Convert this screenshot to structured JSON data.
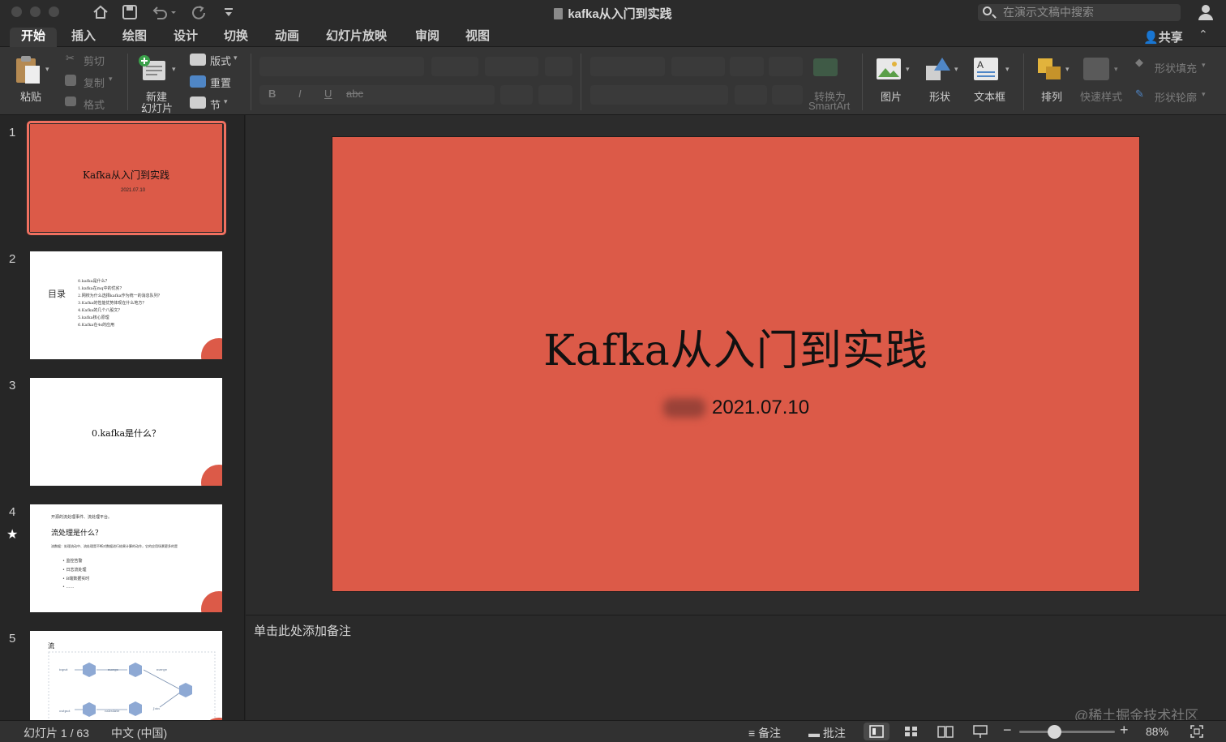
{
  "window": {
    "doc_title": "kafka从入门到实践",
    "search_placeholder": "在演示文稿中搜索"
  },
  "ribbon_tabs": [
    "开始",
    "插入",
    "绘图",
    "设计",
    "切换",
    "动画",
    "幻灯片放映",
    "审阅",
    "视图"
  ],
  "active_tab": "开始",
  "share_label": "共享",
  "ribbon": {
    "paste": "粘贴",
    "cut": "剪切",
    "copy": "复制",
    "format": "格式",
    "new_slide_line1": "新建",
    "new_slide_line2": "幻灯片",
    "layout": "版式",
    "reset": "重置",
    "section": "节",
    "bold": "B",
    "italic": "I",
    "underline": "U",
    "strike": "abc",
    "convert_smartart_line1": "转换为",
    "convert_smartart_line2": "SmartArt",
    "picture": "图片",
    "shape": "形状",
    "textbox": "文本框",
    "arrange": "排列",
    "quick_styles": "快速样式",
    "shape_fill": "形状填充",
    "shape_outline": "形状轮廓"
  },
  "thumbnails": [
    {
      "num": "1",
      "title": "Kafka从入门到实践",
      "date": "2021.07.10"
    },
    {
      "num": "2",
      "side_title": "目录",
      "items": [
        "0.kafka是什么？",
        "1.kafka在mq中的优劣？",
        "2.网校为什么选择kafka作为统一的消息队列？",
        "3.Kafka的性能优势体现在什么地方？",
        "4.Kafka的几个八股文？",
        "5.kafka核心原理",
        "6.Kafka在4s的应用"
      ]
    },
    {
      "num": "3",
      "title": "0.kafka是什么？"
    },
    {
      "num": "4",
      "kicker": "开源的流处理事件、流处理平台。",
      "title": "流处理是什么？",
      "body": "流数据：处理流动中、流处理是不断对数据进行结果计算的动作，它的应用场景更多的是",
      "bullets": [
        "监控告警",
        "日志流处理",
        "B端数据实时",
        "……"
      ]
    },
    {
      "num": "5",
      "title": "流",
      "labels": [
        "input",
        "merge",
        "merge",
        "output",
        "calculate",
        "Join"
      ]
    }
  ],
  "slide": {
    "title": "Kafka从入门到实践",
    "date": "2021.07.10"
  },
  "notes_placeholder": "单击此处添加备注",
  "watermark": "@稀土掘金技术社区",
  "status": {
    "slide_count": "幻灯片 1 / 63",
    "language": "中文 (中国)",
    "notes": "备注",
    "comments": "批注",
    "zoom": "88%",
    "zoom_level": 0.37
  }
}
